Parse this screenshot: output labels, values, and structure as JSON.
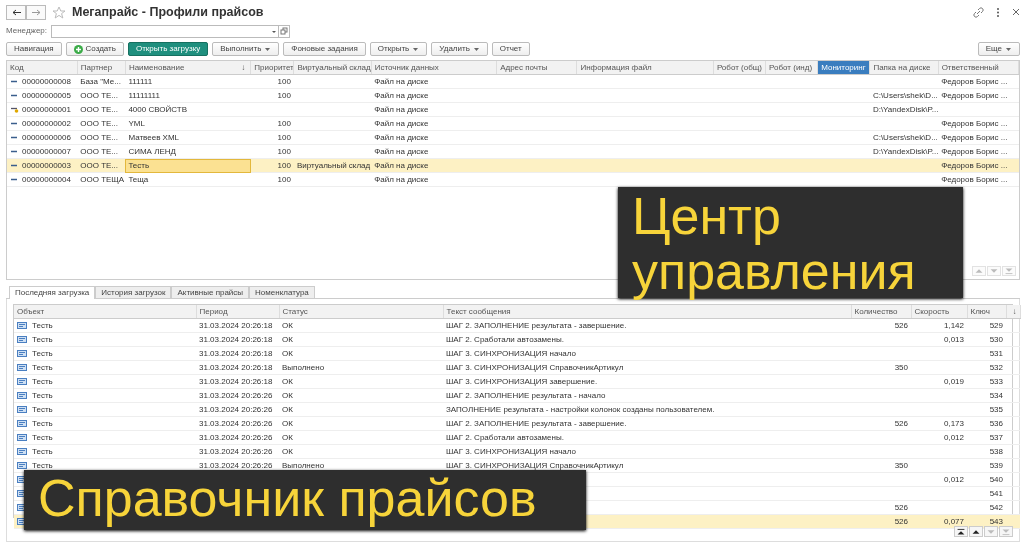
{
  "window": {
    "title": "Мегапрайс - Профили прайсов"
  },
  "filter": {
    "label": "Менеджер:"
  },
  "toolbar": [
    {
      "label": "Навигация",
      "kind": "plain"
    },
    {
      "label": "Создать",
      "kind": "create"
    },
    {
      "label": "Открыть загрузку",
      "kind": "primary"
    },
    {
      "label": "Выполнить",
      "kind": "dropdown"
    },
    {
      "label": "Фоновые задания",
      "kind": "plain"
    },
    {
      "label": "Открыть",
      "kind": "dropdown"
    },
    {
      "label": "Удалить",
      "kind": "dropdown"
    },
    {
      "label": "Отчет",
      "kind": "plain"
    }
  ],
  "more_button": {
    "label": "Еще"
  },
  "profiles": {
    "columns": [
      {
        "label": "Код",
        "selected": false
      },
      {
        "label": "Партнер",
        "selected": false
      },
      {
        "label": "Наименование",
        "selected": false,
        "sort": "↓"
      },
      {
        "label": "Приоритет",
        "selected": false
      },
      {
        "label": "Виртуальный склад",
        "selected": false
      },
      {
        "label": "Источник данных",
        "selected": false
      },
      {
        "label": "Адрес почты",
        "selected": false
      },
      {
        "label": "Информация файл",
        "selected": false
      },
      {
        "label": "Робот (общ)",
        "selected": false
      },
      {
        "label": "Робот (инд)",
        "selected": false
      },
      {
        "label": "Мониторинг",
        "selected": true
      },
      {
        "label": "Папка на диске",
        "selected": false
      },
      {
        "label": "Ответственный",
        "selected": false
      }
    ],
    "rows": [
      {
        "kind": "active",
        "code": "00000000008",
        "partner": "База \"Ме...",
        "name": "111111",
        "priority": "100",
        "source": "Файл на диске",
        "responsible": "Федоров Борис ...",
        "selected": false,
        "focused": false
      },
      {
        "kind": "active",
        "code": "00000000005",
        "partner": "ООО ТЕ...",
        "name": "11111111",
        "priority": "100",
        "source": "Файл на диске",
        "folder": "C:\\Users\\shek\\D...",
        "responsible": "Федоров Борис ...",
        "selected": false,
        "focused": false
      },
      {
        "kind": "draft",
        "code": "00000000001",
        "partner": "ООО ТЕ...",
        "name": "4000 СВОЙСТВ",
        "source": "Файл на диске",
        "folder": "D:\\YandexDisk\\P...",
        "selected": false,
        "focused": false
      },
      {
        "kind": "active",
        "code": "00000000002",
        "partner": "ООО ТЕ...",
        "name": "YML",
        "priority": "100",
        "source": "Файл на диске",
        "responsible": "Федоров Борис ...",
        "selected": false,
        "focused": false
      },
      {
        "kind": "active",
        "code": "00000000006",
        "partner": "ООО ТЕ...",
        "name": "Матвеев XML",
        "priority": "100",
        "source": "Файл на диске",
        "folder": "C:\\Users\\shek\\D...",
        "responsible": "Федоров Борис ...",
        "selected": false,
        "focused": false
      },
      {
        "kind": "active",
        "code": "00000000007",
        "partner": "ООО ТЕ...",
        "name": "СИМА ЛЕНД",
        "priority": "100",
        "source": "Файл на диске",
        "folder": "D:\\YandexDisk\\P...",
        "responsible": "Федоров Борис ...",
        "selected": false,
        "focused": false
      },
      {
        "kind": "active",
        "code": "00000000003",
        "partner": "ООО ТЕ...",
        "name": "Тесть",
        "priority": "100",
        "warehouse": "Виртуальный склад",
        "source": "Файл на диске",
        "responsible": "Федоров Борис ...",
        "selected": true,
        "focused": true
      },
      {
        "kind": "active",
        "code": "00000000004",
        "partner": "ООО ТЕЩА",
        "name": "Теща",
        "priority": "100",
        "source": "Файл на диске",
        "responsible": "Федоров Борис ...",
        "selected": false,
        "focused": false
      }
    ]
  },
  "scroll_buttons": [
    {
      "kind": "up",
      "disabled": true
    },
    {
      "kind": "down",
      "disabled": true
    },
    {
      "kind": "last",
      "disabled": true
    }
  ],
  "tabs": [
    {
      "label": "Последняя загрузка",
      "selected": true
    },
    {
      "label": "История загрузок",
      "selected": false
    },
    {
      "label": "Активные прайсы",
      "selected": false
    },
    {
      "label": "Номенклатура",
      "selected": false
    }
  ],
  "log": {
    "columns": [
      {
        "label": "Объект"
      },
      {
        "label": "Период"
      },
      {
        "label": "Статус"
      },
      {
        "label": "Текст сообщения"
      },
      {
        "label": "Количество"
      },
      {
        "label": "Скорость"
      },
      {
        "label": "Ключ"
      },
      {
        "label": "↓"
      }
    ],
    "rows": [
      {
        "object": "Тесть",
        "period": "31.03.2024 20:26:18",
        "status": "ОК",
        "message": "ШАГ 2. ЗАПОЛНЕНИЕ результата - завершение.",
        "quantity": "526",
        "speed": "1,142",
        "key": "529",
        "selected": false
      },
      {
        "object": "Тесть",
        "period": "31.03.2024 20:26:18",
        "status": "ОК",
        "message": "ШАГ 2. Сработали автозамены.",
        "speed": "0,013",
        "key": "530",
        "selected": false
      },
      {
        "object": "Тесть",
        "period": "31.03.2024 20:26:18",
        "status": "ОК",
        "message": "ШАГ 3. СИНХРОНИЗАЦИЯ начало",
        "key": "531",
        "selected": false
      },
      {
        "object": "Тесть",
        "period": "31.03.2024 20:26:18",
        "status": "Выполнено",
        "message": "ШАГ 3. СИНХРОНИЗАЦИЯ СправочникАртикул",
        "quantity": "350",
        "key": "532",
        "selected": false
      },
      {
        "object": "Тесть",
        "period": "31.03.2024 20:26:18",
        "status": "ОК",
        "message": "ШАГ 3. СИНХРОНИЗАЦИЯ завершение.",
        "speed": "0,019",
        "key": "533",
        "selected": false
      },
      {
        "object": "Тесть",
        "period": "31.03.2024 20:26:26",
        "status": "ОК",
        "message": "ШАГ 2. ЗАПОЛНЕНИЕ результата - начало",
        "key": "534",
        "selected": false
      },
      {
        "object": "Тесть",
        "period": "31.03.2024 20:26:26",
        "status": "ОК",
        "message": "ЗАПОЛНЕНИЕ результата - настройки колонок созданы пользователем.",
        "key": "535",
        "selected": false
      },
      {
        "object": "Тесть",
        "period": "31.03.2024 20:26:26",
        "status": "ОК",
        "message": "ШАГ 2. ЗАПОЛНЕНИЕ результата - завершение.",
        "quantity": "526",
        "speed": "0,173",
        "key": "536",
        "selected": false
      },
      {
        "object": "Тесть",
        "period": "31.03.2024 20:26:26",
        "status": "ОК",
        "message": "ШАГ 2. Сработали автозамены.",
        "speed": "0,012",
        "key": "537",
        "selected": false
      },
      {
        "object": "Тесть",
        "period": "31.03.2024 20:26:26",
        "status": "ОК",
        "message": "ШАГ 3. СИНХРОНИЗАЦИЯ начало",
        "key": "538",
        "selected": false
      },
      {
        "object": "Тесть",
        "period": "31.03.2024 20:26:26",
        "status": "Выполнено",
        "message": "ШАГ 3. СИНХРОНИЗАЦИЯ СправочникАртикул",
        "quantity": "350",
        "key": "539",
        "selected": false
      },
      {
        "speed": "0,012",
        "key": "540",
        "selected": false
      },
      {
        "key": "541",
        "selected": false
      },
      {
        "quantity": "526",
        "key": "542",
        "selected": false
      },
      {
        "quantity": "526",
        "speed": "0,077",
        "key": "543",
        "selected": true
      }
    ]
  },
  "pager": [
    {
      "kind": "first",
      "disabled": false
    },
    {
      "kind": "up",
      "disabled": false
    },
    {
      "kind": "down",
      "disabled": true
    },
    {
      "kind": "last",
      "disabled": true
    }
  ],
  "captions": [
    {
      "text": "Центр управления"
    },
    {
      "text": "Справочник прайсов"
    }
  ]
}
